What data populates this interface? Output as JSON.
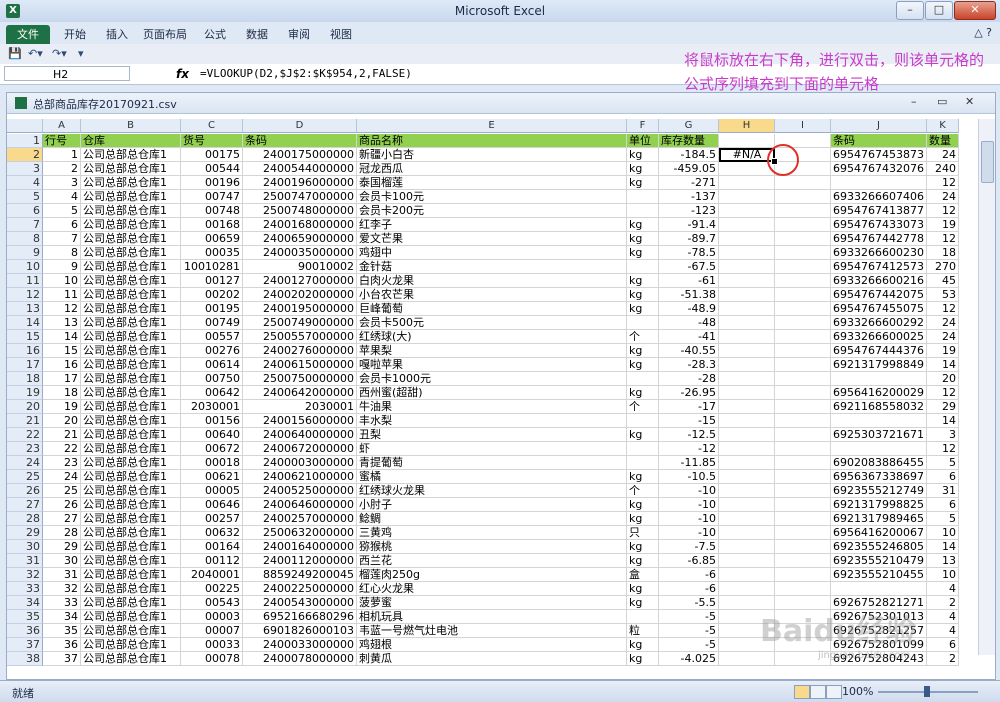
{
  "window": {
    "title": "Microsoft Excel"
  },
  "ribbon": {
    "tabs": [
      "文件",
      "开始",
      "插入",
      "页面布局",
      "公式",
      "数据",
      "审阅",
      "视图"
    ]
  },
  "formula_bar": {
    "name_box": "H2",
    "formula": "=VLOOKUP(D2,$J$2:$K$954,2,FALSE)"
  },
  "annotation": {
    "text": "将鼠标放在右下角，进行双击，则该单元格的公式序列填充到下面的单元格"
  },
  "workbook": {
    "title": "总部商品库存20170921.csv"
  },
  "columns": [
    "A",
    "B",
    "C",
    "D",
    "E",
    "F",
    "G",
    "H",
    "I",
    "J",
    "K"
  ],
  "header_row": [
    "行号",
    "仓库",
    "货号",
    "条码",
    "商品名称",
    "单位",
    "库存数量",
    "",
    "",
    "条码",
    "数量"
  ],
  "rows": [
    [
      "1",
      "公司总部总仓库1",
      "00175",
      "2400175000000",
      "新疆小白杏",
      "kg",
      "-184.5",
      "#N/A",
      "",
      "6954767453873",
      "24"
    ],
    [
      "2",
      "公司总部总仓库1",
      "00544",
      "2400544000000",
      "冠龙西瓜",
      "kg",
      "-459.05",
      "",
      "",
      "6954767432076",
      "240"
    ],
    [
      "3",
      "公司总部总仓库1",
      "00196",
      "2400196000000",
      "泰国榴莲",
      "kg",
      "-271",
      "",
      "",
      "",
      "12"
    ],
    [
      "4",
      "公司总部总仓库1",
      "00747",
      "2500747000000",
      "会员卡100元",
      "",
      "-137",
      "",
      "",
      "6933266607406",
      "24"
    ],
    [
      "5",
      "公司总部总仓库1",
      "00748",
      "2500748000000",
      "会员卡200元",
      "",
      "-123",
      "",
      "",
      "6954767413877",
      "12"
    ],
    [
      "6",
      "公司总部总仓库1",
      "00168",
      "2400168000000",
      "红李子",
      "kg",
      "-91.4",
      "",
      "",
      "6954767433073",
      "19"
    ],
    [
      "7",
      "公司总部总仓库1",
      "00659",
      "2400659000000",
      "爱文芒果",
      "kg",
      "-89.7",
      "",
      "",
      "6954767442778",
      "12"
    ],
    [
      "8",
      "公司总部总仓库1",
      "00035",
      "2400035000000",
      "鸡翅中",
      "kg",
      "-78.5",
      "",
      "",
      "6933266600230",
      "18"
    ],
    [
      "9",
      "公司总部总仓库1",
      "10010281",
      "90010002",
      "金针菇",
      "",
      "-67.5",
      "",
      "",
      "6954767412573",
      "270"
    ],
    [
      "10",
      "公司总部总仓库1",
      "00127",
      "2400127000000",
      "白肉火龙果",
      "kg",
      "-61",
      "",
      "",
      "6933266600216",
      "45"
    ],
    [
      "11",
      "公司总部总仓库1",
      "00202",
      "2400202000000",
      "小台农芒果",
      "kg",
      "-51.38",
      "",
      "",
      "6954767442075",
      "53"
    ],
    [
      "12",
      "公司总部总仓库1",
      "00195",
      "2400195000000",
      "巨峰葡萄",
      "kg",
      "-48.9",
      "",
      "",
      "6954767455075",
      "12"
    ],
    [
      "13",
      "公司总部总仓库1",
      "00749",
      "2500749000000",
      "会员卡500元",
      "",
      "-48",
      "",
      "",
      "6933266600292",
      "24"
    ],
    [
      "14",
      "公司总部总仓库1",
      "00557",
      "2500557000000",
      "红绣球(大)",
      "个",
      "-41",
      "",
      "",
      "6933266600025",
      "24"
    ],
    [
      "15",
      "公司总部总仓库1",
      "00276",
      "2400276000000",
      "苹果梨",
      "kg",
      "-40.55",
      "",
      "",
      "6954767444376",
      "19"
    ],
    [
      "16",
      "公司总部总仓库1",
      "00614",
      "2400615000000",
      "嘎啦苹果",
      "kg",
      "-28.3",
      "",
      "",
      "6921317998849",
      "14"
    ],
    [
      "17",
      "公司总部总仓库1",
      "00750",
      "2500750000000",
      "会员卡1000元",
      "",
      "-28",
      "",
      "",
      "",
      "20"
    ],
    [
      "18",
      "公司总部总仓库1",
      "00642",
      "2400642000000",
      "西州蜜(超甜)",
      "kg",
      "-26.95",
      "",
      "",
      "6956416200029",
      "12"
    ],
    [
      "19",
      "公司总部总仓库1",
      "2030001",
      "2030001",
      "牛油果",
      "个",
      "-17",
      "",
      "",
      "6921168558032",
      "29"
    ],
    [
      "20",
      "公司总部总仓库1",
      "00156",
      "2400156000000",
      "丰水梨",
      "",
      "-15",
      "",
      "",
      "",
      "14"
    ],
    [
      "21",
      "公司总部总仓库1",
      "00640",
      "2400640000000",
      "丑梨",
      "kg",
      "-12.5",
      "",
      "",
      "6925303721671",
      "3"
    ],
    [
      "22",
      "公司总部总仓库1",
      "00672",
      "2400672000000",
      "虾",
      "",
      "-12",
      "",
      "",
      "",
      "12"
    ],
    [
      "23",
      "公司总部总仓库1",
      "00018",
      "2400003000000",
      "青提葡萄",
      "",
      "-11.85",
      "",
      "",
      "6902083886455",
      "5"
    ],
    [
      "24",
      "公司总部总仓库1",
      "00621",
      "2400621000000",
      "蜜橘",
      "kg",
      "-10.5",
      "",
      "",
      "6956367338697",
      "6"
    ],
    [
      "25",
      "公司总部总仓库1",
      "00005",
      "2400525000000",
      "红绣球火龙果",
      "个",
      "-10",
      "",
      "",
      "6923555212749",
      "31"
    ],
    [
      "26",
      "公司总部总仓库1",
      "00646",
      "2400646000000",
      "小肘子",
      "kg",
      "-10",
      "",
      "",
      "6921317998825",
      "6"
    ],
    [
      "27",
      "公司总部总仓库1",
      "00257",
      "2400257000000",
      "鲶鲷",
      "kg",
      "-10",
      "",
      "",
      "6921317989465",
      "5"
    ],
    [
      "28",
      "公司总部总仓库1",
      "00632",
      "2500632000000",
      "三黄鸡",
      "只",
      "-10",
      "",
      "",
      "6956416200067",
      "10"
    ],
    [
      "29",
      "公司总部总仓库1",
      "00164",
      "2400164000000",
      "猕猴桃",
      "kg",
      "-7.5",
      "",
      "",
      "6923555246805",
      "14"
    ],
    [
      "30",
      "公司总部总仓库1",
      "00112",
      "2400112000000",
      "西兰花",
      "kg",
      "-6.85",
      "",
      "",
      "6923555210479",
      "13"
    ],
    [
      "31",
      "公司总部总仓库1",
      "2040001",
      "8859249200045",
      "榴莲肉250g",
      "盒",
      "-6",
      "",
      "",
      "6923555210455",
      "10"
    ],
    [
      "32",
      "公司总部总仓库1",
      "00225",
      "2400225000000",
      "红心火龙果",
      "kg",
      "-6",
      "",
      "",
      "",
      "4"
    ],
    [
      "33",
      "公司总部总仓库1",
      "00543",
      "2400543000000",
      "菠萝蜜",
      "kg",
      "-5.5",
      "",
      "",
      "6926752821271",
      "2"
    ],
    [
      "34",
      "公司总部总仓库1",
      "00003",
      "6952166680296",
      "相机玩具",
      "",
      "-5",
      "",
      "",
      "6926752301013",
      "4"
    ],
    [
      "35",
      "公司总部总仓库1",
      "00007",
      "6901826000103",
      "韦蓝一号燃气灶电池",
      "粒",
      "-5",
      "",
      "",
      "6926752821257",
      "4"
    ],
    [
      "36",
      "公司总部总仓库1",
      "00033",
      "2400033000000",
      "鸡翅根",
      "kg",
      "-5",
      "",
      "",
      "6926752801099",
      "6"
    ],
    [
      "37",
      "公司总部总仓库1",
      "00078",
      "2400078000000",
      "刺黄瓜",
      "kg",
      "-4.025",
      "",
      "",
      "6926752804243",
      "2"
    ]
  ],
  "row_numbers": [
    "1",
    "2",
    "3",
    "4",
    "5",
    "6",
    "7",
    "8",
    "9",
    "10",
    "11",
    "12",
    "13",
    "14",
    "15",
    "16",
    "17",
    "18",
    "19",
    "20",
    "21",
    "22",
    "23",
    "24",
    "25",
    "26",
    "27",
    "28",
    "29",
    "30",
    "31",
    "32",
    "33",
    "34",
    "35",
    "36",
    "37",
    "38"
  ],
  "status": {
    "ready": "就绪",
    "zoom": "100%"
  },
  "watermark": {
    "brand": "Baidu经验",
    "url": "jingyan.baidu.com"
  }
}
